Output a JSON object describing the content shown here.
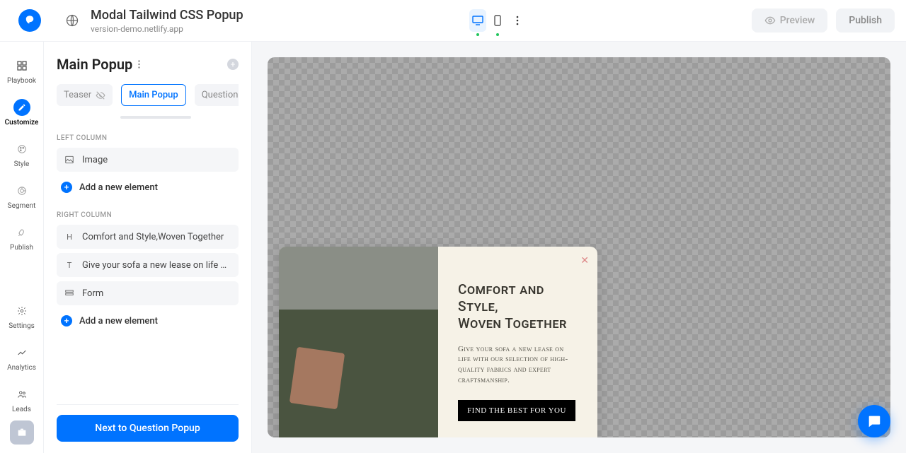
{
  "header": {
    "title": "Modal Tailwind CSS Popup",
    "subtitle": "version-demo.netlify.app",
    "preview_label": "Preview",
    "publish_label": "Publish"
  },
  "leftnav": {
    "items": [
      {
        "label": "Playbook"
      },
      {
        "label": "Customize"
      },
      {
        "label": "Style"
      },
      {
        "label": "Segment"
      },
      {
        "label": "Publish"
      }
    ],
    "bottom_items": [
      {
        "label": "Settings"
      },
      {
        "label": "Analytics"
      },
      {
        "label": "Leads"
      }
    ]
  },
  "panel": {
    "title": "Main Popup",
    "tabs": [
      {
        "label": "Teaser"
      },
      {
        "label": "Main Popup"
      },
      {
        "label": "Question Po..."
      }
    ],
    "left_column_label": "LEFT COLUMN",
    "right_column_label": "RIGHT COLUMN",
    "left_elements": [
      {
        "kind": "image",
        "label": "Image"
      }
    ],
    "right_elements": [
      {
        "kind": "heading",
        "label": "Comfort and Style,Woven Together"
      },
      {
        "kind": "text",
        "label": "Give your sofa a new lease on life with our ..."
      },
      {
        "kind": "form",
        "label": "Form"
      }
    ],
    "add_element_label": "Add a new element",
    "next_btn_label": "Next to Question Popup"
  },
  "popup": {
    "heading_line1": "Comfort and Style,",
    "heading_line2": "Woven Together",
    "body": "Give your sofa a new lease on life with our selection of high-quality fabrics and expert craftsmanship.",
    "cta": "FIND THE BEST FOR YOU"
  }
}
